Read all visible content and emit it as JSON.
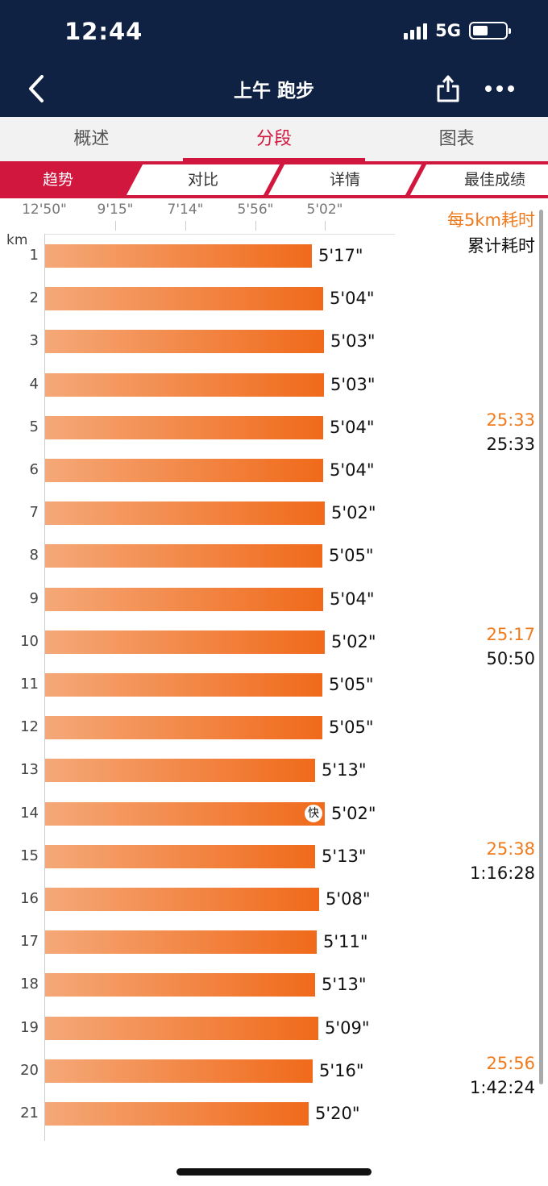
{
  "status_bar": {
    "time": "12:44",
    "network": "5G",
    "battery": 0.35
  },
  "header": {
    "title": "上午 跑步"
  },
  "tabs": [
    {
      "label": "概述",
      "active": false
    },
    {
      "label": "分段",
      "active": true
    },
    {
      "label": "图表",
      "active": false
    }
  ],
  "subtabs": [
    {
      "label": "趋势",
      "active": true
    },
    {
      "label": "对比",
      "active": false
    },
    {
      "label": "详情",
      "active": false
    },
    {
      "label": "最佳成绩",
      "active": false
    }
  ],
  "scale_labels": [
    "12'50\"",
    "9'15\"",
    "7'14\"",
    "5'56\"",
    "5'02\""
  ],
  "unit": "km",
  "legend": {
    "split_label": "每5km耗时",
    "cumulative_label": "累计耗时"
  },
  "fast_badge": "快",
  "laps": [
    {
      "km": "1",
      "pace": "5'17\""
    },
    {
      "km": "2",
      "pace": "5'04\""
    },
    {
      "km": "3",
      "pace": "5'03\""
    },
    {
      "km": "4",
      "pace": "5'03\""
    },
    {
      "km": "5",
      "pace": "5'04\""
    },
    {
      "km": "6",
      "pace": "5'04\""
    },
    {
      "km": "7",
      "pace": "5'02\""
    },
    {
      "km": "8",
      "pace": "5'05\""
    },
    {
      "km": "9",
      "pace": "5'04\""
    },
    {
      "km": "10",
      "pace": "5'02\""
    },
    {
      "km": "11",
      "pace": "5'05\""
    },
    {
      "km": "12",
      "pace": "5'05\""
    },
    {
      "km": "13",
      "pace": "5'13\""
    },
    {
      "km": "14",
      "pace": "5'02\"",
      "fastest": true
    },
    {
      "km": "15",
      "pace": "5'13\""
    },
    {
      "km": "16",
      "pace": "5'08\""
    },
    {
      "km": "17",
      "pace": "5'11\""
    },
    {
      "km": "18",
      "pace": "5'13\""
    },
    {
      "km": "19",
      "pace": "5'09\""
    },
    {
      "km": "20",
      "pace": "5'16\""
    },
    {
      "km": "21",
      "pace": "5'20\""
    }
  ],
  "splits": [
    {
      "after_km": 5,
      "split_time": "25:33",
      "cumulative": "25:33"
    },
    {
      "after_km": 10,
      "split_time": "25:17",
      "cumulative": "50:50"
    },
    {
      "after_km": 15,
      "split_time": "25:38",
      "cumulative": "1:16:28"
    },
    {
      "after_km": 20,
      "split_time": "25:56",
      "cumulative": "1:42:24"
    }
  ],
  "colors": {
    "header_bg": "#0f2244",
    "accent_red": "#d2173f",
    "bar_orange": "#f06a1a",
    "split_orange": "#f07b1d"
  }
}
